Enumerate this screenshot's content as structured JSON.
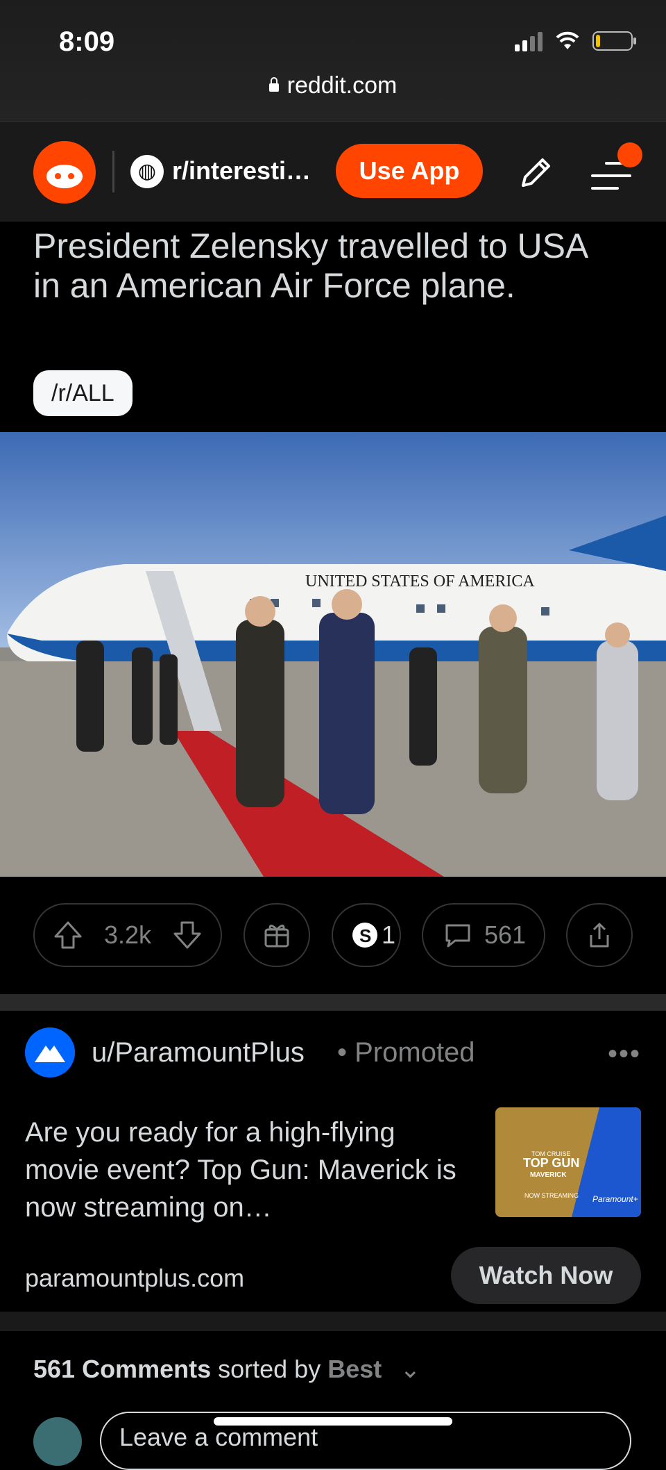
{
  "status_bar": {
    "time": "8:09"
  },
  "browser": {
    "url": "reddit.com"
  },
  "header": {
    "subreddit": "r/interesti…",
    "use_app_label": "Use App"
  },
  "post": {
    "title": "President Zelensky travelled to USA in an American Air Force plane.",
    "flair": "/r/ALL",
    "image_caption": "UNITED STATES OF AMERICA",
    "votes": "3.2k",
    "awards": "1",
    "comments": "561"
  },
  "promoted": {
    "user": "u/ParamountPlus",
    "tag": "Promoted",
    "text": "Are you ready for a high-flying movie event? Top Gun: Maverick is now streaming on…",
    "domain": "paramountplus.com",
    "cta": "Watch Now",
    "thumb_lines": [
      "TOM CRUISE",
      "TOP GUN",
      "MAVERICK",
      "NOW STREAMING",
      "Paramount+"
    ]
  },
  "comments_section": {
    "count_label": "561 Comments",
    "sorted_by_label": "sorted by",
    "sort": "Best",
    "placeholder": "Leave a comment"
  }
}
